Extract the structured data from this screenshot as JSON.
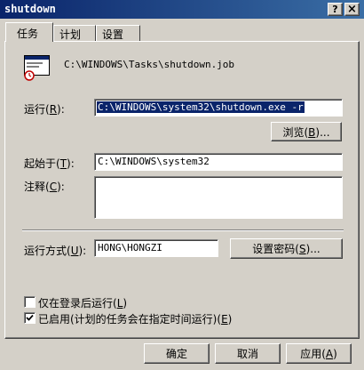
{
  "window": {
    "title": "shutdown",
    "help_label": "?",
    "close_label": "×"
  },
  "tabs": [
    "任务",
    "计划",
    "设置"
  ],
  "task": {
    "job_path": "C:\\WINDOWS\\Tasks\\shutdown.job",
    "run": {
      "label": "运行",
      "key": "R",
      "value": "C:\\WINDOWS\\system32\\shutdown.exe -r"
    },
    "browse": {
      "label": "浏览",
      "key": "B",
      "suffix": "..."
    },
    "start_in": {
      "label": "起始于",
      "key": "T",
      "value": "C:\\WINDOWS\\system32"
    },
    "comments": {
      "label": "注释",
      "key": "C",
      "value": ""
    },
    "run_as": {
      "label": "运行方式",
      "key": "U",
      "value": "HONG\\HONGZI"
    },
    "set_password": {
      "label": "设置密码",
      "key": "S",
      "suffix": "..."
    },
    "only_logged_on": {
      "label": "仅在登录后运行",
      "key": "L",
      "checked": false
    },
    "enabled": {
      "label": "已启用(计划的任务会在指定时间运行)",
      "key": "E",
      "checked": true
    }
  },
  "footer": {
    "ok": "确定",
    "cancel": "取消",
    "apply": {
      "label": "应用",
      "key": "A"
    }
  },
  "colors": {
    "title_bar": "#0a246a",
    "face": "#d4d0c8",
    "selection": "#0a246a"
  }
}
